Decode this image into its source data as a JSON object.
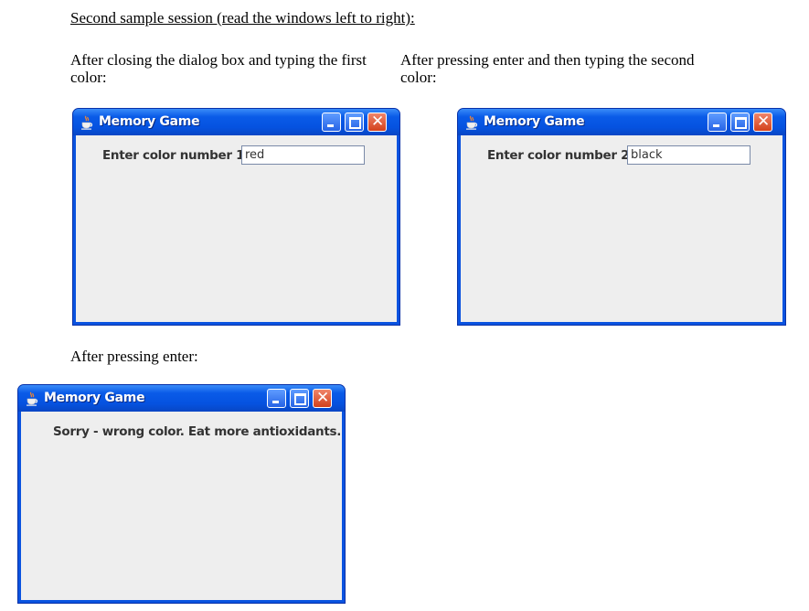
{
  "document": {
    "heading": "Second sample session (read the windows left to right):",
    "caption_1": "After closing the dialog box and typing the first color:",
    "caption_2": "After pressing enter and then typing the second color:",
    "caption_3": "After pressing enter:"
  },
  "windows": [
    {
      "title": "Memory Game",
      "icon": "java-cup-icon",
      "controls": [
        "minimize",
        "maximize",
        "close"
      ],
      "field_label": "Enter color number 1:",
      "field_value": "red"
    },
    {
      "title": "Memory Game",
      "icon": "java-cup-icon",
      "controls": [
        "minimize",
        "maximize",
        "close"
      ],
      "field_label": "Enter color number 2:",
      "field_value": "black"
    },
    {
      "title": "Memory Game",
      "icon": "java-cup-icon",
      "controls": [
        "minimize",
        "maximize",
        "close"
      ],
      "message": "Sorry - wrong color. Eat more antioxidants."
    }
  ],
  "colors": {
    "titlebar_blue": "#0552e0",
    "close_button": "#d3411c",
    "content_bg": "#eeeeee"
  }
}
